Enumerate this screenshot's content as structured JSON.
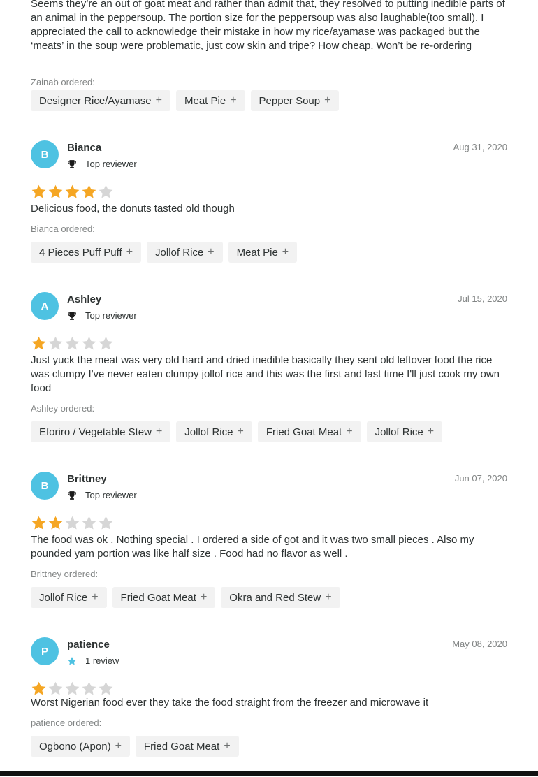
{
  "top_review": {
    "comment": "Seems they’re an out of goat meat and rather than admit that, they resolved to putting inedible parts of an animal in the peppersoup. The portion size for the peppersoup was also laughable(too small). I appreciated the call to acknowledge their mistake in how my rice/ayamase was packaged but the ‘meats’ in the soup were problematic, just cow skin and tripe? How cheap. Won’t be re-ordering",
    "ordered_label": "Zainab ordered:",
    "items": [
      "Designer Rice/Ayamase",
      "Meat Pie",
      "Pepper Soup"
    ]
  },
  "reviews": [
    {
      "initial": "B",
      "name": "Bianca",
      "badge": "Top reviewer",
      "badge_icon": "trophy-icon",
      "date": "Aug 31, 2020",
      "rating": 4,
      "comment": "Delicious food, the donuts tasted old though",
      "ordered_label": "Bianca ordered:",
      "items": [
        "4 Pieces Puff Puff",
        "Jollof Rice",
        "Meat Pie"
      ]
    },
    {
      "initial": "A",
      "name": "Ashley",
      "badge": "Top reviewer",
      "badge_icon": "trophy-icon",
      "date": "Jul 15, 2020",
      "rating": 1,
      "comment": "Just yuck the meat was very old hard and dried inedible basically they sent old leftover food the rice was clumpy I've never eaten clumpy jollof rice and this was the first and last time I'll just cook my own food",
      "ordered_label": "Ashley ordered:",
      "items": [
        "Eforiro / Vegetable Stew",
        "Jollof Rice",
        "Fried Goat Meat",
        "Jollof Rice"
      ]
    },
    {
      "initial": "B",
      "name": "Brittney",
      "badge": "Top reviewer",
      "badge_icon": "trophy-icon",
      "date": "Jun 07, 2020",
      "rating": 2,
      "comment": "The food was ok . Nothing special . I ordered a side of got and it was two small pieces . Also my pounded yam portion was like half size . Food had no flavor as well .",
      "ordered_label": "Brittney ordered:",
      "items": [
        "Jollof Rice",
        "Fried Goat Meat",
        "Okra and Red Stew"
      ]
    },
    {
      "initial": "P",
      "name": "patience",
      "badge": "1 review",
      "badge_icon": "star-icon",
      "date": "May 08, 2020",
      "rating": 1,
      "comment": "Worst Nigerian food ever they take the food straight from the freezer and microwave it",
      "ordered_label": "patience ordered:",
      "items": [
        "Ogbono (Apon)",
        "Fried Goat Meat"
      ]
    }
  ],
  "colors": {
    "avatar": "#4ec2e2",
    "star_filled": "#f5a623",
    "star_empty": "#d6d6d6",
    "chip_bg": "#f2f2f2",
    "badge_star": "#4ec2e2"
  }
}
